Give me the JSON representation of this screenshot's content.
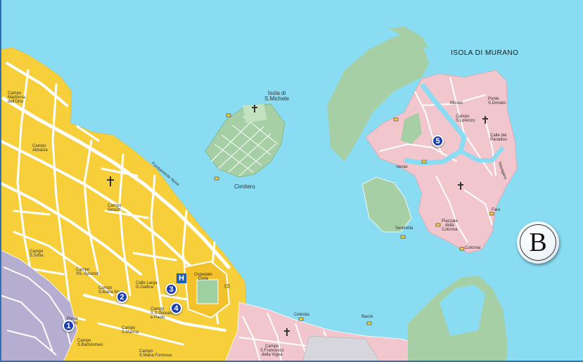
{
  "labels": {
    "murano": "ISOLA DI MURANO",
    "san_michele": "Isola di\nS.Michele",
    "cimitero": "Cimitero",
    "ospedale": "Ospedale\nCivile",
    "fondamente_nove": "Fondamente Nove",
    "celestia": "Celestia",
    "bacini": "Bacini",
    "faro": "Faro",
    "colonna": "Colonna",
    "venier": "Venier",
    "serenella": "Serenella",
    "navagero": "Navagero",
    "museo": "Museo",
    "faro_stop": "Faro",
    "campo_ss_apostoli": "Campo\nSS. Apostoli",
    "campo_gesuiti": "Campo\nGesuiti",
    "campo_s_marina": "Campo\nS.Marina",
    "campo_ss_giovanni": "Campo\nS.S.Giovanni\ne Paolo",
    "calle_larga": "Calle Larga\nG.Gallina",
    "campo_s_maria_nova": "Campo\nS.Maria Nova",
    "ponte_rialto": "Ponte\nRialto",
    "campo_s_bartolomeo": "Campo\nS.Bartolomeo",
    "campo_s_maria_formosa": "Campo\nS.Maria Formosa",
    "campo_s_francesco": "Campo\nS.Francesco\ndella Vigna",
    "ponte_donato": "Ponte\nS.Donato",
    "calle_paradiso": "Calle del\nParadiso",
    "piazzale_colonna": "Piazzale\ndella\nColonna",
    "campo_s_lorenzo": "Campo\nS.Lorenzo",
    "campo_s_sofia": "Campo\nS.Sofia",
    "campo_madonna": "Campo\nMadonna\ndell'Orto",
    "campo_abbazia": "Campo\nAbbazia"
  },
  "markers": [
    "1",
    "2",
    "3",
    "4",
    "5"
  ],
  "hospital": "H",
  "logo": "B",
  "colors": {
    "water": "#8adcf3",
    "land_cannaregio": "#f6cf3b",
    "streets": "#ffffff",
    "land_murano": "#f1c6cd",
    "green": "#a7cfa6",
    "marker": "#1d3fae",
    "frame": "#2f6fb5"
  },
  "icons": [
    "cross-icon",
    "boat-stop-icon",
    "hospital-icon"
  ]
}
